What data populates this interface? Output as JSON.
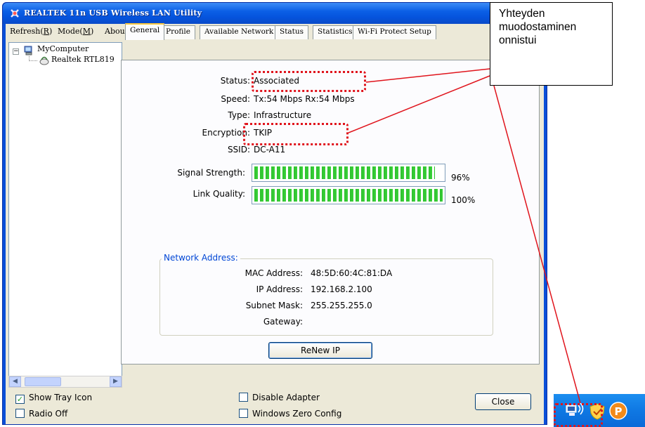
{
  "window": {
    "title": "REALTEK 11n USB Wireless LAN Utility"
  },
  "menu": [
    {
      "label": "Refresh(",
      "key": "R",
      "tail": ")"
    },
    {
      "label": "Mode(",
      "key": "M",
      "tail": ")"
    },
    {
      "label": "About(",
      "key": "A",
      "tail": ")"
    }
  ],
  "tree": {
    "root": "MyComputer",
    "child": "Realtek RTL819",
    "expander": "−"
  },
  "tabs": [
    "General",
    "Profile",
    "Available Network",
    "Status",
    "Statistics",
    "Wi-Fi Protect Setup"
  ],
  "active_tab": "General",
  "general": {
    "status_label": "Status:",
    "status_value": "Associated",
    "speed_label": "Speed:",
    "speed_value": "Tx:54 Mbps Rx:54 Mbps",
    "type_label": "Type:",
    "type_value": "Infrastructure",
    "encryption_label": "Encryption:",
    "encryption_value": "TKIP",
    "ssid_label": "SSID:",
    "ssid_value": "DC-A11",
    "signal_label": "Signal Strength:",
    "signal_value": 0.96,
    "signal_text": "96%",
    "link_label": "Link Quality:",
    "link_value": 1.0,
    "link_text": "100%"
  },
  "network": {
    "group_title": "Network Address:",
    "mac_label": "MAC Address:",
    "mac_value": "48:5D:60:4C:81:DA",
    "ip_label": "IP Address:",
    "ip_value": "192.168.2.100",
    "mask_label": "Subnet Mask:",
    "mask_value": "255.255.255.0",
    "gateway_label": "Gateway:",
    "gateway_value": "",
    "renew_button": "ReNew IP"
  },
  "bottom": {
    "show_tray_icon": {
      "label": "Show Tray Icon",
      "checked": true
    },
    "radio_off": {
      "label": "Radio Off",
      "checked": false
    },
    "disable_adapter": {
      "label": "Disable Adapter",
      "checked": false
    },
    "windows_zero_config": {
      "label": "Windows Zero Config",
      "checked": false
    },
    "close_button": "Close"
  },
  "callout": {
    "lines": [
      "Yhteyden",
      "muodostaminen",
      "onnistui"
    ]
  },
  "colors": {
    "highlight": "#e0141c",
    "bar_green": "#39d339",
    "title_blue": "#0b5fe6",
    "group_title": "#0046d5"
  },
  "icons": [
    "app-icon",
    "computer-icon",
    "adapter-icon",
    "wireless-tray-icon",
    "shield-tray-icon",
    "p-tray-icon"
  ]
}
